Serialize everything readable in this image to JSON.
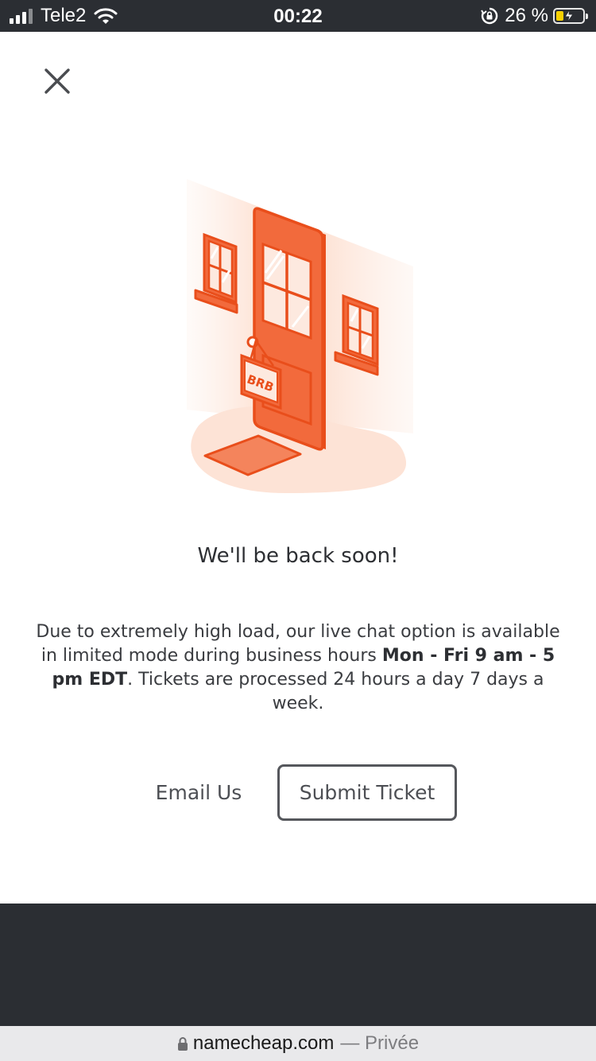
{
  "status_bar": {
    "carrier": "Tele2",
    "time": "00:22",
    "battery_percent": "26 %",
    "battery_level": 0.26,
    "icons": [
      "signal-icon",
      "wifi-icon",
      "rotation-lock-icon",
      "battery-charging-icon"
    ]
  },
  "modal": {
    "close_icon": "close-icon",
    "illustration_sign": "BRB",
    "headline": "We'll be back soon!",
    "message": {
      "part1": "Due to extremely high load, our live chat option is available in limited mode during business hours ",
      "hours": "Mon - Fri 9 am - 5 pm EDT",
      "part2": ". Tickets are processed 24 hours a day 7 days a week."
    },
    "email_label": "Email Us",
    "submit_label": "Submit Ticket"
  },
  "url_bar": {
    "domain": "namecheap.com",
    "mode": "— Privée"
  },
  "colors": {
    "accent": "#f05a28",
    "accent_light": "#f4845c",
    "dark": "#2b2e33"
  }
}
